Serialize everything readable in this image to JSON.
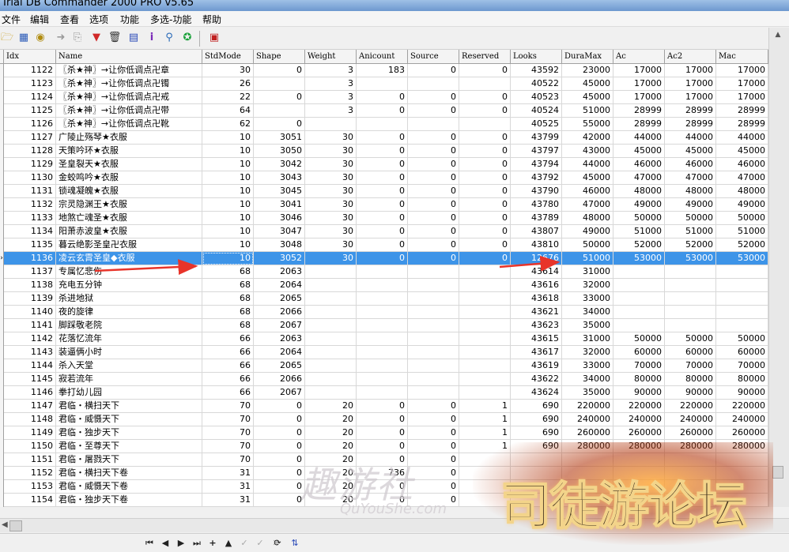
{
  "window": {
    "title": "Trial DB Commander 2000 PRO v5.65"
  },
  "menu": [
    "文件",
    "编辑",
    "查看",
    "选项",
    "功能",
    "多选-功能",
    "帮助"
  ],
  "toolbar": {
    "icons": [
      "open-folder-icon",
      "grid-view-icon",
      "search-binoculars-icon",
      "forward-arrow-icon",
      "export-icon",
      "filter-icon",
      "delete-trash-icon",
      "database-icon",
      "info-icon",
      "find-replace-icon",
      "run-icon",
      "exit-icon"
    ]
  },
  "grid": {
    "columns": [
      "Idx",
      "Name",
      "StdMode",
      "Shape",
      "Weight",
      "Anicount",
      "Source",
      "Reserved",
      "Looks",
      "DuraMax",
      "Ac",
      "Ac2",
      "Mac"
    ],
    "selected_index": 14,
    "rows": [
      [
        "1122",
        "〖杀★神〗→让你低调点卍章",
        "30",
        "0",
        "3",
        "183",
        "0",
        "0",
        "43592",
        "23000",
        "17000",
        "17000",
        "17000"
      ],
      [
        "1123",
        "〖杀★神〗→让你低调点卍镯",
        "26",
        "",
        "3",
        "",
        "",
        "",
        "40522",
        "45000",
        "17000",
        "17000",
        "17000"
      ],
      [
        "1124",
        "〖杀★神〗→让你低调点卍戒",
        "22",
        "0",
        "3",
        "0",
        "0",
        "0",
        "40523",
        "45000",
        "17000",
        "17000",
        "17000"
      ],
      [
        "1125",
        "〖杀★神〗→让你低调点卍带",
        "64",
        "",
        "3",
        "0",
        "0",
        "0",
        "40524",
        "51000",
        "28999",
        "28999",
        "28999"
      ],
      [
        "1126",
        "〖杀★神〗→让你低调点卍靴",
        "62",
        "0",
        "",
        "",
        "",
        "",
        "40525",
        "55000",
        "28999",
        "28999",
        "28999"
      ],
      [
        "1127",
        "广陵止殇琴★衣服",
        "10",
        "3051",
        "30",
        "0",
        "0",
        "0",
        "43799",
        "42000",
        "44000",
        "44000",
        "44000"
      ],
      [
        "1128",
        "天策吟环★衣服",
        "10",
        "3050",
        "30",
        "0",
        "0",
        "0",
        "43797",
        "43000",
        "45000",
        "45000",
        "45000"
      ],
      [
        "1129",
        "圣皇裂天★衣服",
        "10",
        "3042",
        "30",
        "0",
        "0",
        "0",
        "43794",
        "44000",
        "46000",
        "46000",
        "46000"
      ],
      [
        "1130",
        "金蛟鸣吟★衣服",
        "10",
        "3043",
        "30",
        "0",
        "0",
        "0",
        "43792",
        "45000",
        "47000",
        "47000",
        "47000"
      ],
      [
        "1131",
        "锁魂凝魄★衣服",
        "10",
        "3045",
        "30",
        "0",
        "0",
        "0",
        "43790",
        "46000",
        "48000",
        "48000",
        "48000"
      ],
      [
        "1132",
        "宗灵隐渊王★衣服",
        "10",
        "3041",
        "30",
        "0",
        "0",
        "0",
        "43780",
        "47000",
        "49000",
        "49000",
        "49000"
      ],
      [
        "1133",
        "地煞亡魂圣★衣服",
        "10",
        "3046",
        "30",
        "0",
        "0",
        "0",
        "43789",
        "48000",
        "50000",
        "50000",
        "50000"
      ],
      [
        "1134",
        "阳萧赤波皇★衣服",
        "10",
        "3047",
        "30",
        "0",
        "0",
        "0",
        "43807",
        "49000",
        "51000",
        "51000",
        "51000"
      ],
      [
        "1135",
        "暮云绝影圣皇卍衣服",
        "10",
        "3048",
        "30",
        "0",
        "0",
        "0",
        "43810",
        "50000",
        "52000",
        "52000",
        "52000"
      ],
      [
        "1136",
        "凌云玄霄圣皇◆衣服",
        "10",
        "3052",
        "30",
        "0",
        "0",
        "0",
        "12676",
        "51000",
        "53000",
        "53000",
        "53000"
      ],
      [
        "1137",
        "专属忆悲伤",
        "68",
        "2063",
        "",
        "",
        "",
        "",
        "43614",
        "31000",
        "",
        "",
        ""
      ],
      [
        "1138",
        "充电五分钟",
        "68",
        "2064",
        "",
        "",
        "",
        "",
        "43616",
        "32000",
        "",
        "",
        ""
      ],
      [
        "1139",
        "杀进地狱",
        "68",
        "2065",
        "",
        "",
        "",
        "",
        "43618",
        "33000",
        "",
        "",
        ""
      ],
      [
        "1140",
        "夜的旋律",
        "68",
        "2066",
        "",
        "",
        "",
        "",
        "43621",
        "34000",
        "",
        "",
        ""
      ],
      [
        "1141",
        "脚踩敬老院",
        "68",
        "2067",
        "",
        "",
        "",
        "",
        "43623",
        "35000",
        "",
        "",
        ""
      ],
      [
        "1142",
        "花落忆流年",
        "66",
        "2063",
        "",
        "",
        "",
        "",
        "43615",
        "31000",
        "50000",
        "50000",
        "50000"
      ],
      [
        "1143",
        "装逼俩小时",
        "66",
        "2064",
        "",
        "",
        "",
        "",
        "43617",
        "32000",
        "60000",
        "60000",
        "60000"
      ],
      [
        "1144",
        "杀入天堂",
        "66",
        "2065",
        "",
        "",
        "",
        "",
        "43619",
        "33000",
        "70000",
        "70000",
        "70000"
      ],
      [
        "1145",
        "寂若流年",
        "66",
        "2066",
        "",
        "",
        "",
        "",
        "43622",
        "34000",
        "80000",
        "80000",
        "80000"
      ],
      [
        "1146",
        "拳打幼儿园",
        "66",
        "2067",
        "",
        "",
        "",
        "",
        "43624",
        "35000",
        "90000",
        "90000",
        "90000"
      ],
      [
        "1147",
        "君临・横扫天下",
        "70",
        "0",
        "20",
        "0",
        "0",
        "1",
        "690",
        "220000",
        "220000",
        "220000",
        "220000"
      ],
      [
        "1148",
        "君临・威慑天下",
        "70",
        "0",
        "20",
        "0",
        "0",
        "1",
        "690",
        "240000",
        "240000",
        "240000",
        "240000"
      ],
      [
        "1149",
        "君临・独步天下",
        "70",
        "0",
        "20",
        "0",
        "0",
        "1",
        "690",
        "260000",
        "260000",
        "260000",
        "260000"
      ],
      [
        "1150",
        "君临・至尊天下",
        "70",
        "0",
        "20",
        "0",
        "0",
        "1",
        "690",
        "280000",
        "280000",
        "280000",
        "280000"
      ],
      [
        "1151",
        "君临・屠戮天下",
        "70",
        "0",
        "20",
        "0",
        "0",
        "",
        "",
        "",
        "",
        "",
        ""
      ],
      [
        "1152",
        "君临・横扫天下卷",
        "31",
        "0",
        "20",
        "736",
        "0",
        "",
        "",
        "",
        "",
        "",
        ""
      ],
      [
        "1153",
        "君临・威慑天下卷",
        "31",
        "0",
        "20",
        "0",
        "0",
        "",
        "",
        "",
        "",
        "",
        ""
      ],
      [
        "1154",
        "君临・独步天下卷",
        "31",
        "0",
        "20",
        "0",
        "0",
        "",
        "",
        "",
        "",
        "",
        ""
      ]
    ]
  },
  "watermark": {
    "left_text": "趣游社",
    "left_sub": "QuYouShe.com",
    "right_text": "司徒游论坛"
  },
  "colors": {
    "selection": "#3d94e8",
    "annotation_arrow": "#e8342a"
  },
  "navigator": {
    "icons": [
      "first-record-icon",
      "prior-record-icon",
      "next-record-icon",
      "last-record-icon",
      "insert-record-icon",
      "delete-record-icon",
      "edit-record-icon",
      "post-record-icon",
      "cancel-record-icon",
      "refresh-icon",
      "apply-updates-icon"
    ]
  }
}
